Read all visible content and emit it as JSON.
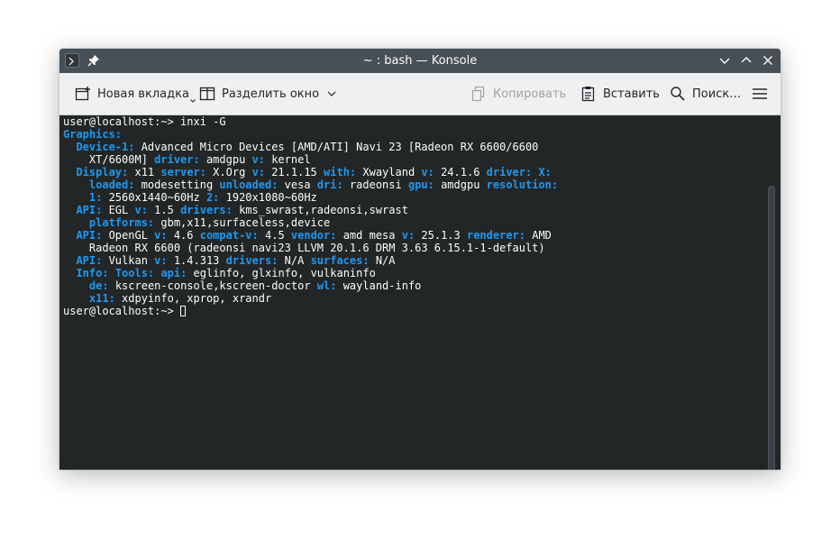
{
  "window": {
    "title": "~ : bash — Konsole"
  },
  "toolbar": {
    "new_tab": "Новая вкладка",
    "split": "Разделить окно",
    "copy": "Копировать",
    "paste": "Вставить",
    "find": "Поиск…"
  },
  "terminal": {
    "lines": [
      [
        {
          "t": "user@localhost:~> inxi -G",
          "k": false
        }
      ],
      [
        {
          "t": "Graphics:",
          "k": true
        }
      ],
      [
        {
          "t": "  ",
          "k": false
        },
        {
          "t": "Device-1:",
          "k": true
        },
        {
          "t": " Advanced Micro Devices [AMD/ATI] Navi 23 [Radeon RX 6600/6600",
          "k": false
        }
      ],
      [
        {
          "t": "    XT/6600M] ",
          "k": false
        },
        {
          "t": "driver:",
          "k": true
        },
        {
          "t": " amdgpu ",
          "k": false
        },
        {
          "t": "v:",
          "k": true
        },
        {
          "t": " kernel",
          "k": false
        }
      ],
      [
        {
          "t": "  ",
          "k": false
        },
        {
          "t": "Display:",
          "k": true
        },
        {
          "t": " x11 ",
          "k": false
        },
        {
          "t": "server:",
          "k": true
        },
        {
          "t": " X.Org ",
          "k": false
        },
        {
          "t": "v:",
          "k": true
        },
        {
          "t": " 21.1.15 ",
          "k": false
        },
        {
          "t": "with:",
          "k": true
        },
        {
          "t": " Xwayland ",
          "k": false
        },
        {
          "t": "v:",
          "k": true
        },
        {
          "t": " 24.1.6 ",
          "k": false
        },
        {
          "t": "driver:",
          "k": true
        },
        {
          "t": " ",
          "k": false
        },
        {
          "t": "X:",
          "k": true
        }
      ],
      [
        {
          "t": "    ",
          "k": false
        },
        {
          "t": "loaded:",
          "k": true
        },
        {
          "t": " modesetting ",
          "k": false
        },
        {
          "t": "unloaded:",
          "k": true
        },
        {
          "t": " vesa ",
          "k": false
        },
        {
          "t": "dri:",
          "k": true
        },
        {
          "t": " radeonsi ",
          "k": false
        },
        {
          "t": "gpu:",
          "k": true
        },
        {
          "t": " amdgpu ",
          "k": false
        },
        {
          "t": "resolution:",
          "k": true
        }
      ],
      [
        {
          "t": "    ",
          "k": false
        },
        {
          "t": "1:",
          "k": true
        },
        {
          "t": " 2560x1440~60Hz ",
          "k": false
        },
        {
          "t": "2:",
          "k": true
        },
        {
          "t": " 1920x1080~60Hz",
          "k": false
        }
      ],
      [
        {
          "t": "  ",
          "k": false
        },
        {
          "t": "API:",
          "k": true
        },
        {
          "t": " EGL ",
          "k": false
        },
        {
          "t": "v:",
          "k": true
        },
        {
          "t": " 1.5 ",
          "k": false
        },
        {
          "t": "drivers:",
          "k": true
        },
        {
          "t": " kms_swrast,radeonsi,swrast",
          "k": false
        }
      ],
      [
        {
          "t": "    ",
          "k": false
        },
        {
          "t": "platforms:",
          "k": true
        },
        {
          "t": " gbm,x11,surfaceless,device",
          "k": false
        }
      ],
      [
        {
          "t": "  ",
          "k": false
        },
        {
          "t": "API:",
          "k": true
        },
        {
          "t": " OpenGL ",
          "k": false
        },
        {
          "t": "v:",
          "k": true
        },
        {
          "t": " 4.6 ",
          "k": false
        },
        {
          "t": "compat-v:",
          "k": true
        },
        {
          "t": " 4.5 ",
          "k": false
        },
        {
          "t": "vendor:",
          "k": true
        },
        {
          "t": " amd mesa ",
          "k": false
        },
        {
          "t": "v:",
          "k": true
        },
        {
          "t": " 25.1.3 ",
          "k": false
        },
        {
          "t": "renderer:",
          "k": true
        },
        {
          "t": " AMD",
          "k": false
        }
      ],
      [
        {
          "t": "    Radeon RX 6600 (radeonsi navi23 LLVM 20.1.6 DRM 3.63 6.15.1-1-default)",
          "k": false
        }
      ],
      [
        {
          "t": "  ",
          "k": false
        },
        {
          "t": "API:",
          "k": true
        },
        {
          "t": " Vulkan ",
          "k": false
        },
        {
          "t": "v:",
          "k": true
        },
        {
          "t": " 1.4.313 ",
          "k": false
        },
        {
          "t": "drivers:",
          "k": true
        },
        {
          "t": " N/A ",
          "k": false
        },
        {
          "t": "surfaces:",
          "k": true
        },
        {
          "t": " N/A",
          "k": false
        }
      ],
      [
        {
          "t": "  ",
          "k": false
        },
        {
          "t": "Info:",
          "k": true
        },
        {
          "t": " ",
          "k": false
        },
        {
          "t": "Tools:",
          "k": true
        },
        {
          "t": " ",
          "k": false
        },
        {
          "t": "api:",
          "k": true
        },
        {
          "t": " eglinfo, glxinfo, vulkaninfo",
          "k": false
        }
      ],
      [
        {
          "t": "    ",
          "k": false
        },
        {
          "t": "de:",
          "k": true
        },
        {
          "t": " kscreen-console,kscreen-doctor ",
          "k": false
        },
        {
          "t": "wl:",
          "k": true
        },
        {
          "t": " wayland-info",
          "k": false
        }
      ],
      [
        {
          "t": "    ",
          "k": false
        },
        {
          "t": "x11:",
          "k": true
        },
        {
          "t": " xdpyinfo, xprop, xrandr",
          "k": false
        }
      ]
    ],
    "prompt": "user@localhost:~> "
  }
}
